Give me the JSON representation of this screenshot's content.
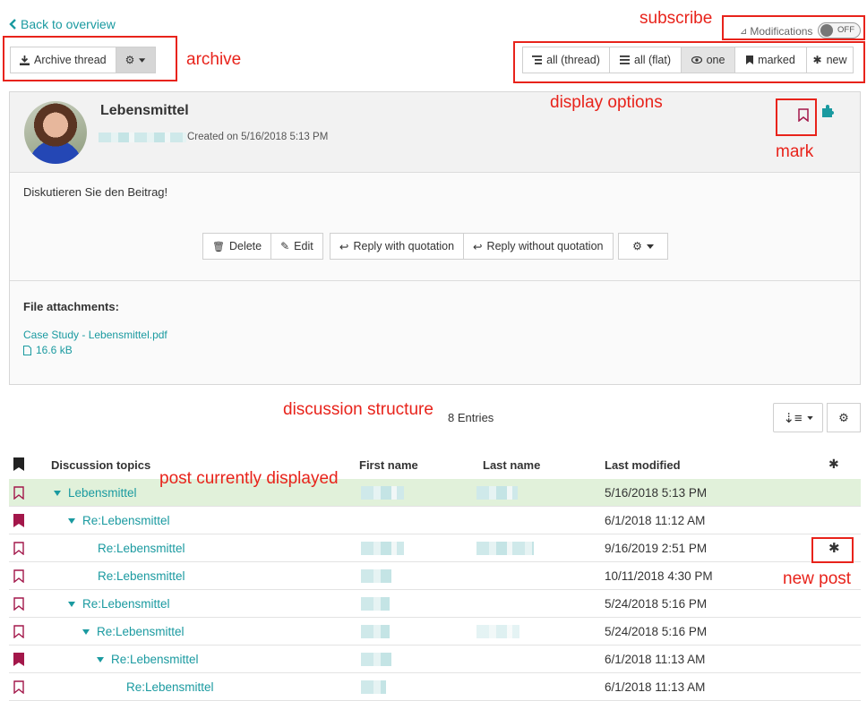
{
  "nav": {
    "back_label": "Back to overview"
  },
  "toolbar": {
    "archive_label": "Archive thread"
  },
  "subscribe": {
    "label": "Modifications",
    "state": "OFF"
  },
  "view_options": [
    {
      "label": "all (thread)",
      "icon": "indent-list-icon"
    },
    {
      "label": "all (flat)",
      "icon": "flat-list-icon"
    },
    {
      "label": "one",
      "icon": "eye-icon",
      "active": true
    },
    {
      "label": "marked",
      "icon": "bookmark-icon"
    },
    {
      "label": "new",
      "icon": "asterisk-icon"
    }
  ],
  "post": {
    "title": "Lebensmittel",
    "created": "Created on 5/16/2018 5:13 PM",
    "body": "Diskutieren Sie den Beitrag!",
    "actions": {
      "delete": "Delete",
      "edit": "Edit",
      "reply_quote": "Reply with quotation",
      "reply_noquote": "Reply without quotation"
    },
    "attachments_title": "File attachments:",
    "attachment": {
      "name": "Case Study - Lebensmittel.pdf",
      "size": "16.6 kB"
    }
  },
  "entries": {
    "count_label": "8 Entries"
  },
  "table": {
    "columns": {
      "topic": "Discussion topics",
      "first": "First name",
      "last": "Last name",
      "modified": "Last modified",
      "new": "✱"
    },
    "rows": [
      {
        "topic": "Lebensmittel",
        "level": 0,
        "caret": true,
        "marked": false,
        "modified": "5/16/2018 5:13 PM",
        "highlight": true,
        "new": ""
      },
      {
        "topic": "Re:Lebensmittel",
        "level": 1,
        "caret": true,
        "marked": true,
        "modified": "6/1/2018 11:12 AM",
        "highlight": false,
        "new": ""
      },
      {
        "topic": "Re:Lebensmittel",
        "level": 2,
        "caret": false,
        "marked": false,
        "modified": "9/16/2019 2:51 PM",
        "highlight": false,
        "new": "✱"
      },
      {
        "topic": "Re:Lebensmittel",
        "level": 2,
        "caret": false,
        "marked": false,
        "modified": "10/11/2018 4:30 PM",
        "highlight": false,
        "new": ""
      },
      {
        "topic": "Re:Lebensmittel",
        "level": 1,
        "caret": true,
        "marked": false,
        "modified": "5/24/2018 5:16 PM",
        "highlight": false,
        "new": ""
      },
      {
        "topic": "Re:Lebensmittel",
        "level": 2,
        "caret": true,
        "marked": false,
        "modified": "5/24/2018 5:16 PM",
        "highlight": false,
        "new": ""
      },
      {
        "topic": "Re:Lebensmittel",
        "level": 3,
        "caret": true,
        "marked": true,
        "modified": "6/1/2018 11:13 AM",
        "highlight": false,
        "new": ""
      },
      {
        "topic": "Re:Lebensmittel",
        "level": 4,
        "caret": false,
        "marked": false,
        "modified": "6/1/2018 11:13 AM",
        "highlight": false,
        "new": ""
      }
    ]
  },
  "annotations": {
    "subscribe": "subscribe",
    "archive": "archive",
    "display_options": "display options",
    "mark": "mark",
    "discussion_structure": "discussion structure",
    "post_displayed": "post currently displayed",
    "new_post": "new post"
  },
  "colors": {
    "accent": "#1a9aa0",
    "annotation": "#e8231b",
    "bookmark": "#a3174a",
    "highlight": "#e1f1da"
  }
}
